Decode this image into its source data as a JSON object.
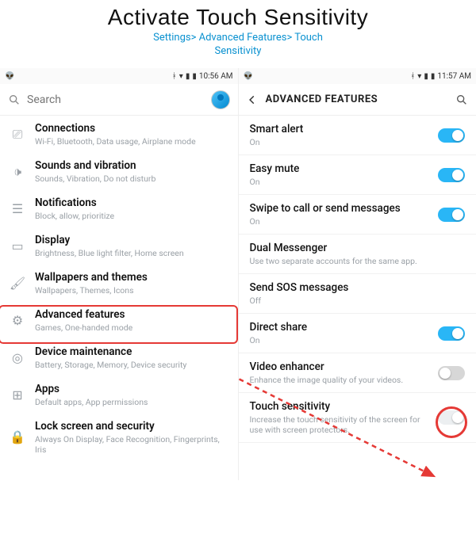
{
  "heading": {
    "title": "Activate Touch Sensitivity",
    "breadcrumb": "Settings> Advanced Features> Touch\nSensitivity",
    "accent": "#0a91d0"
  },
  "left": {
    "status_time": "10:56 AM",
    "search_placeholder": "Search",
    "items": [
      {
        "icon": "connections-icon",
        "glyph": "⎚",
        "label": "Connections",
        "sub": "Wi-Fi, Bluetooth, Data usage, Airplane mode"
      },
      {
        "icon": "sound-icon",
        "glyph": "🕩",
        "label": "Sounds and vibration",
        "sub": "Sounds, Vibration, Do not disturb"
      },
      {
        "icon": "notifications-icon",
        "glyph": "☰",
        "label": "Notifications",
        "sub": "Block, allow, prioritize"
      },
      {
        "icon": "display-icon",
        "glyph": "▭",
        "label": "Display",
        "sub": "Brightness, Blue light filter, Home screen"
      },
      {
        "icon": "wallpaper-icon",
        "glyph": "🖌",
        "label": "Wallpapers and themes",
        "sub": "Wallpapers, Themes, Icons"
      },
      {
        "icon": "advanced-icon",
        "glyph": "⚙",
        "label": "Advanced features",
        "sub": "Games, One-handed mode"
      },
      {
        "icon": "maintenance-icon",
        "glyph": "◎",
        "label": "Device maintenance",
        "sub": "Battery, Storage, Memory, Device security"
      },
      {
        "icon": "apps-icon",
        "glyph": "⊞",
        "label": "Apps",
        "sub": "Default apps, App permissions"
      },
      {
        "icon": "lock-icon",
        "glyph": "🔒",
        "label": "Lock screen and security",
        "sub": "Always On Display, Face Recognition, Fingerprints, Iris"
      }
    ],
    "highlight_index": 5
  },
  "right": {
    "status_time": "11:57 AM",
    "header": "ADVANCED FEATURES",
    "items": [
      {
        "label": "Smart alert",
        "sub": "On",
        "toggle": "on"
      },
      {
        "label": "Easy mute",
        "sub": "On",
        "toggle": "on"
      },
      {
        "label": "Swipe to call or send messages",
        "sub": "On",
        "toggle": "on"
      },
      {
        "label": "Dual Messenger",
        "sub": "Use two separate accounts for the same app.",
        "toggle": null
      },
      {
        "label": "Send SOS messages",
        "sub": "Off",
        "toggle": null
      },
      {
        "label": "Direct share",
        "sub": "On",
        "toggle": "on"
      },
      {
        "label": "Video enhancer",
        "sub": "Enhance the image quality of your videos.",
        "toggle": "off"
      },
      {
        "label": "Touch sensitivity",
        "sub": "Increase the touch sensitivity of the screen for use with screen protectors.",
        "toggle": "half"
      }
    ],
    "circle_index": 7
  },
  "colors": {
    "highlight": "#e53935",
    "toggle_on": "#29b6f6"
  }
}
